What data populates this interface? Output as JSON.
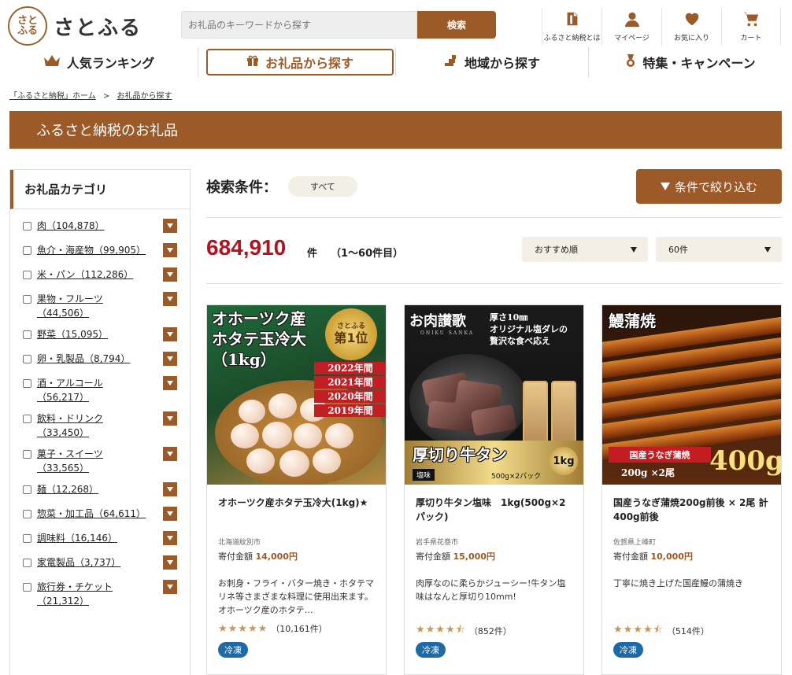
{
  "header": {
    "logo_mark": "さと\nふる",
    "logo_text": "さとふる",
    "search_placeholder": "お礼品のキーワードから探す",
    "search_button": "検索",
    "icons": [
      {
        "label": "ふるさと納税とは",
        "icon": "book-icon"
      },
      {
        "label": "マイページ",
        "icon": "user-icon"
      },
      {
        "label": "お気に入り",
        "icon": "heart-icon"
      },
      {
        "label": "カート",
        "icon": "cart-icon"
      }
    ]
  },
  "nav": {
    "ranking": "人気ランキング",
    "gifts": "お礼品から探す",
    "region": "地域から探す",
    "campaign": "特集・キャンペーン"
  },
  "breadcrumb": {
    "home": "「ふるさと納税」ホーム",
    "separator": ">",
    "current": "お礼品から探す"
  },
  "banner": {
    "title": "ふるさと納税のお礼品"
  },
  "sidebar": {
    "title": "お礼品カテゴリ",
    "categories": [
      {
        "label": "肉（104,878）"
      },
      {
        "label": "魚介・海産物（99,905）"
      },
      {
        "label": "米・パン（112,286）"
      },
      {
        "label": "果物・フルーツ（44,506）"
      },
      {
        "label": "野菜（15,095）"
      },
      {
        "label": "卵・乳製品（8,794）"
      },
      {
        "label": "酒・アルコール（56,217）"
      },
      {
        "label": "飲料・ドリンク（33,450）"
      },
      {
        "label": "菓子・スイーツ（33,565）"
      },
      {
        "label": "麺（12,268）"
      },
      {
        "label": "惣菜・加工品（64,611）"
      },
      {
        "label": "調味料（16,146）"
      },
      {
        "label": "家電製品（3,737）"
      },
      {
        "label": "旅行券・チケット（21,312）"
      }
    ]
  },
  "main": {
    "condition_label": "検索条件：",
    "condition_value": "すべて",
    "filter_button": "条件で絞り込む",
    "count": "684,910",
    "count_unit": "件",
    "count_range": "（1～60件目）",
    "sort_select": "おすすめ順",
    "per_page_select": "60件"
  },
  "cards": [
    {
      "title": "オホーツク産ホタテ玉冷大(1kg)★",
      "region": "北海道紋別市",
      "price_label": "寄付金額",
      "price": "14,000円",
      "desc": "お刺身・フライ・バター焼き・ホタテマリネ等さまざまな料理に使用出来ます。オホーツク産のホタテ…",
      "rating": 5,
      "reviews": "（10,161件）",
      "badge": "冷凍",
      "image": {
        "title": "オホーツク産\nホタテ玉冷大\n（1kg）",
        "medal_top": "さとふる",
        "medal_rank": "第1位",
        "years": [
          "2022年間",
          "2021年間",
          "2020年間",
          "2019年間"
        ]
      }
    },
    {
      "title": "厚切り牛タン塩味　1kg(500g×2パック)",
      "region": "岩手県花巻市",
      "price_label": "寄付金額",
      "price": "15,000円",
      "desc": "肉厚なのに柔らかジューシー!牛タン塩味はなんと厚切り10mm!",
      "rating": 4.5,
      "reviews": "（852件）",
      "badge": "冷凍",
      "image": {
        "brand": "お肉讃歌",
        "brand_sub": "ONIKU SANKA",
        "copy": "厚さ10㎜\nオリジナル塩ダレの\n贅沢な食べ応え",
        "name": "厚切り牛タン",
        "tag": "塩味",
        "qty": "500g×2パック",
        "kg": "1kg"
      }
    },
    {
      "title": "国産うなぎ蒲焼200g前後 × 2尾 計400g前後",
      "region": "佐賀県上峰町",
      "price_label": "寄付金額",
      "price": "10,000円",
      "desc": "丁寧に焼き上げた国産鰻の蒲焼き",
      "rating": 4.5,
      "reviews": "（514件）",
      "badge": "冷凍",
      "image": {
        "title": "鰻蒲焼",
        "label": "国産うなぎ蒲焼",
        "sub": "200g ×2尾",
        "big": "400g"
      }
    }
  ],
  "colors": {
    "brand": "#9b5a27",
    "price": "#9b5a27",
    "count": "#b1131f",
    "badge": "#1e6aa6"
  }
}
